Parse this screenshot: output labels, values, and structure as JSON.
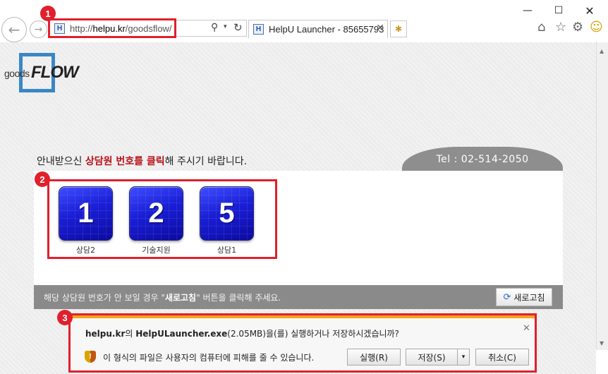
{
  "browser": {
    "window_controls": {
      "minimize": "—",
      "maximize": "☐",
      "close": "✕"
    },
    "nav": {
      "back_icon": "←",
      "forward_icon": "→"
    },
    "address": {
      "favicon_letter": "H",
      "url_prefix": "http://",
      "url_domain": "helpu.kr",
      "url_path": "/goodsflow/",
      "search_icon": "⚲",
      "dropdown_icon": "▾",
      "refresh_icon": "↻"
    },
    "tab": {
      "favicon_letter": "H",
      "title": "HelpU Launcher - 85655793",
      "close_icon": "✕"
    },
    "newtab_icon": "✱",
    "tools": {
      "home_icon": "⌂",
      "favorites_icon": "☆",
      "settings_icon": "⚙",
      "feedback_icon": "☺"
    }
  },
  "annotations": [
    {
      "number": "1"
    },
    {
      "number": "2"
    },
    {
      "number": "3"
    }
  ],
  "logo": {
    "goods": "goods",
    "flow": "FLOW"
  },
  "instruction": {
    "before": "안내받으신 ",
    "highlight": "상담원 번호를 클릭",
    "after": "해 주시기 바랍니다."
  },
  "tel": "Tel : 02-514-2050",
  "consultants": [
    {
      "number": "1",
      "label": "상담2"
    },
    {
      "number": "2",
      "label": "기술지원"
    },
    {
      "number": "5",
      "label": "상담1"
    }
  ],
  "infobar": {
    "before": "해당 상담원 번호가 안 보일 경우 \"",
    "bold": "새로고침",
    "after": "\" 버튼을 클릭해 주세요.",
    "refresh_icon": "⟳",
    "refresh_label": "새로고침"
  },
  "download": {
    "site": "helpu.kr",
    "mid1": "의 ",
    "file": "HelpULauncher.exe",
    "rest": "(2.05MB)을(를) 실행하거나 저장하시겠습니까?",
    "shield_mark": "!",
    "warning": "이 형식의 파일은 사용자의 컴퓨터에 피해를 줄 수 있습니다.",
    "run": "실행(R)",
    "save": "저장(S)",
    "save_dropdown": "▾",
    "cancel": "취소(C)",
    "close_icon": "✕"
  },
  "scroll": {
    "up": "▲",
    "down": "▼"
  }
}
